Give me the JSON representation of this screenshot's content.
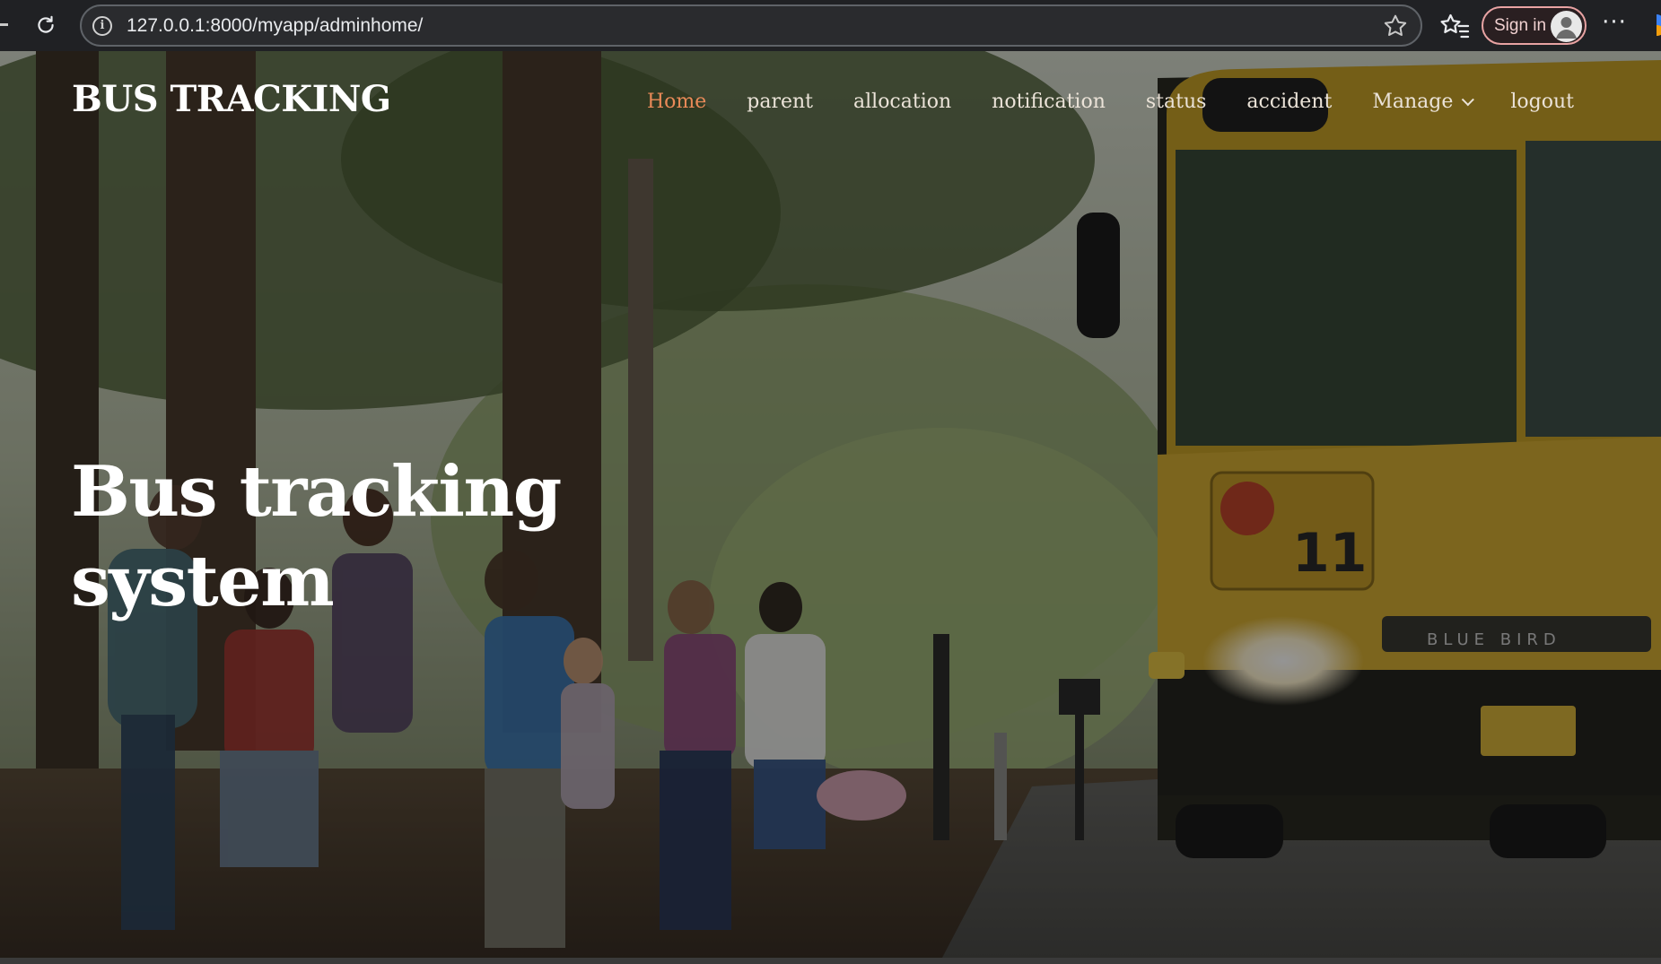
{
  "browser": {
    "url": "127.0.0.1:8000/myapp/adminhome/",
    "signin_label": "Sign in",
    "more_label": "···"
  },
  "site": {
    "logo": "BUS TRACKING",
    "nav": [
      {
        "label": "Home",
        "active": true
      },
      {
        "label": "parent"
      },
      {
        "label": "allocation"
      },
      {
        "label": "notification"
      },
      {
        "label": "status"
      },
      {
        "label": "accident"
      },
      {
        "label": "Manage"
      },
      {
        "label": "logout"
      }
    ]
  },
  "hero": {
    "title_line1": "Bus tracking",
    "title_line2": "system"
  },
  "colors": {
    "nav_active": "#e98a58",
    "nav_text": "#ebe3d8",
    "bus_yellow": "#c9a228"
  },
  "icons": {
    "reload": "reload-icon",
    "info": "info-icon",
    "star": "star-icon",
    "favorites": "favorites-icon",
    "avatar": "avatar-icon",
    "more": "more-icon",
    "chevron": "chevron-down-icon"
  }
}
